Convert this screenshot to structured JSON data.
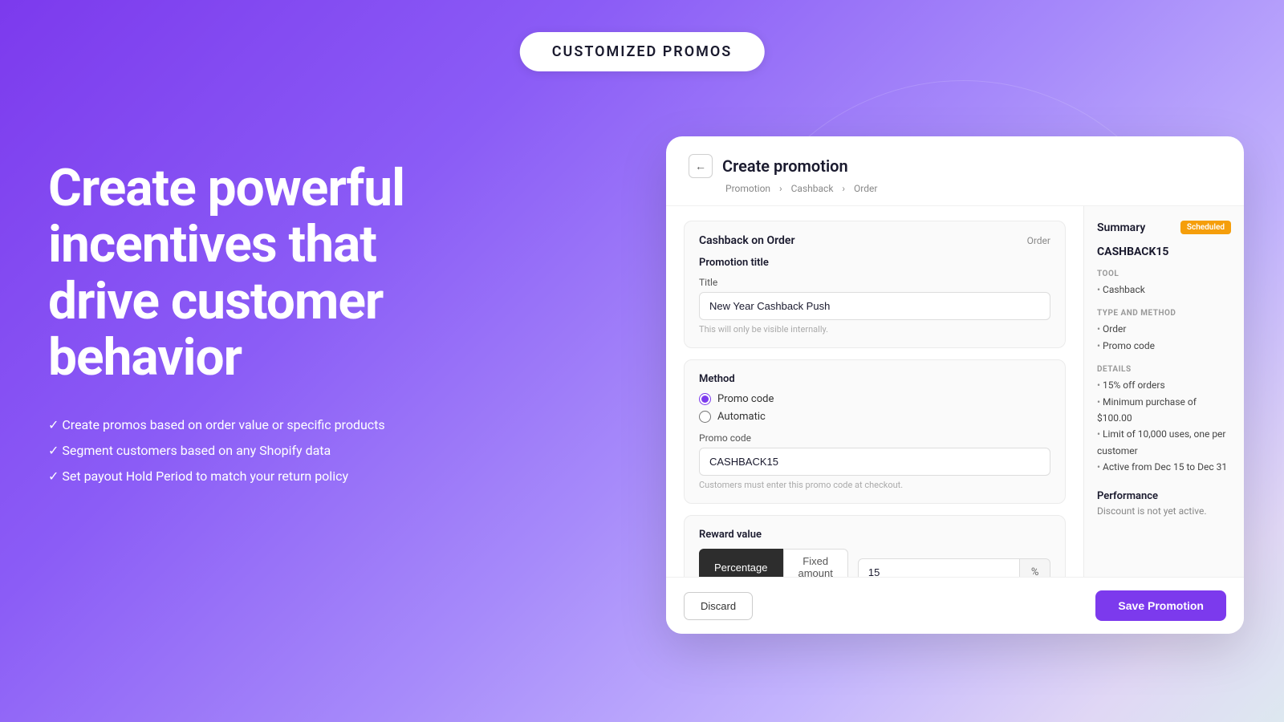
{
  "badge": {
    "label": "CUSTOMIZED PROMOS"
  },
  "hero": {
    "heading": "Create powerful incentives that drive customer behavior",
    "bullets": [
      "Create promos based on order value or specific products",
      "Segment customers based on any Shopify data",
      "Set payout Hold Period to match your return policy"
    ]
  },
  "card": {
    "back_label": "←",
    "title": "Create promotion",
    "breadcrumb": {
      "items": [
        "Promotion",
        "Cashback",
        "Order"
      ],
      "separator": ">"
    },
    "cashback_section": {
      "title": "Cashback on Order",
      "badge": "Order",
      "promotion_title_label": "Promotion title",
      "title_field_label": "Title",
      "title_value": "New Year Cashback Push",
      "title_hint": "This will only be visible internally."
    },
    "method_section": {
      "title": "Method",
      "options": [
        "Promo code",
        "Automatic"
      ],
      "selected": "Promo code",
      "promo_code_label": "Promo code",
      "promo_code_value": "CASHBACK15",
      "promo_code_hint": "Customers must enter this promo code at checkout."
    },
    "reward_section": {
      "title": "Reward value",
      "toggle_options": [
        "Percentage",
        "Fixed amount"
      ],
      "selected_toggle": "Percentage",
      "value": "15",
      "suffix": "%"
    },
    "footer": {
      "discard_label": "Discard",
      "save_label": "Save Promotion"
    },
    "summary": {
      "title": "Summary",
      "status_badge": "Scheduled",
      "promo_name": "CASHBACK15",
      "tool_label": "TOOL",
      "tool_items": [
        "Cashback"
      ],
      "type_method_label": "TYPE AND METHOD",
      "type_method_items": [
        "Order",
        "Promo code"
      ],
      "details_label": "DETAILS",
      "details_items": [
        "15% off orders",
        "Minimum purchase of $100.00",
        "Limit of 10,000 uses, one per customer",
        "Active from  Dec 15 to Dec 31"
      ],
      "performance_title": "Performance",
      "performance_text": "Discount is not yet active."
    }
  }
}
